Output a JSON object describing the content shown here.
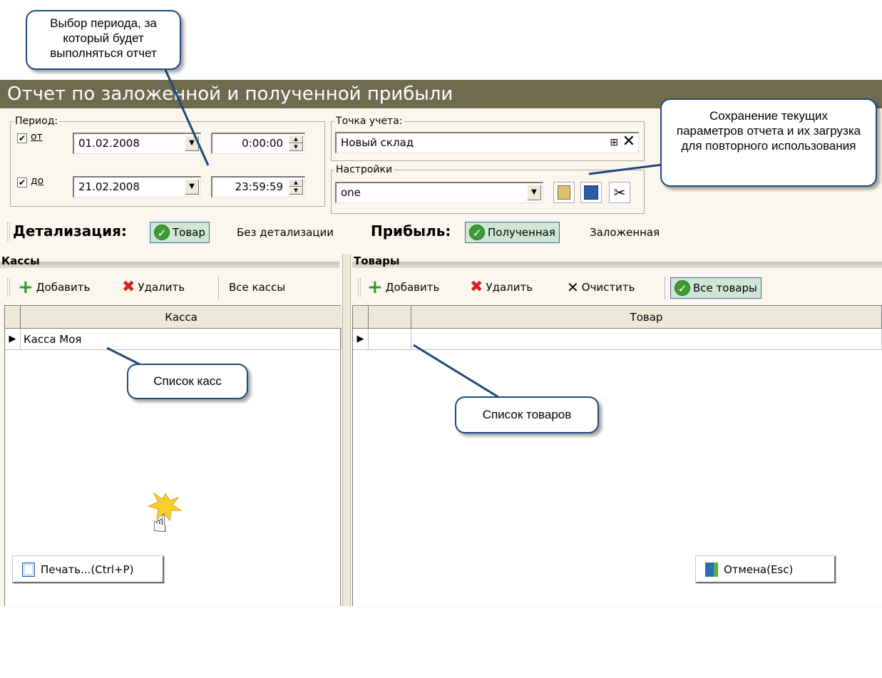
{
  "window": {
    "title": "Отчет по заложенной и полученной прибыли"
  },
  "period": {
    "legend": "Период:",
    "from": {
      "label": "от",
      "checked": true,
      "date": "01.02.2008",
      "time": "0:00:00"
    },
    "to": {
      "label": "до",
      "checked": true,
      "date": "21.02.2008",
      "time": "23:59:59"
    }
  },
  "point": {
    "legend": "Точка учета:",
    "value": "Новый склад"
  },
  "settings": {
    "legend": "Настройки",
    "value": "one"
  },
  "detail": {
    "label": "Детализация:",
    "options": [
      "Товар",
      "Без детализации"
    ],
    "selected": "Товар"
  },
  "profit": {
    "label": "Прибыль:",
    "options": [
      "Полученная",
      "Заложенная"
    ],
    "selected": "Полученная"
  },
  "kassy": {
    "header": "Кассы",
    "toolbar": {
      "add": "Добавить",
      "delete": "Удалить",
      "all": "Все кассы"
    },
    "column": "Касса",
    "rows": [
      "Касса Моя"
    ]
  },
  "tovary": {
    "header": "Товары",
    "toolbar": {
      "add": "Добавить",
      "delete": "Удалить",
      "clear": "Очистить",
      "all": "Все товары"
    },
    "column": "Товар",
    "rows": [
      ""
    ]
  },
  "footer": {
    "print": "Печать...(Ctrl+P)",
    "cancel": "Отмена(Esc)"
  },
  "callouts": {
    "period": "Выбор периода, за который будет выполняться отчет",
    "save": "Сохранение текущих параметров отчета и их загрузка для повторного использования",
    "kassy": "Список касс",
    "tovary": "Список товаров"
  },
  "colors": {
    "title_bg": "#6e6b4f",
    "window_bg": "#fbf7ee",
    "selected_bg": "#cfe6d5",
    "callout_border": "#20477c"
  }
}
